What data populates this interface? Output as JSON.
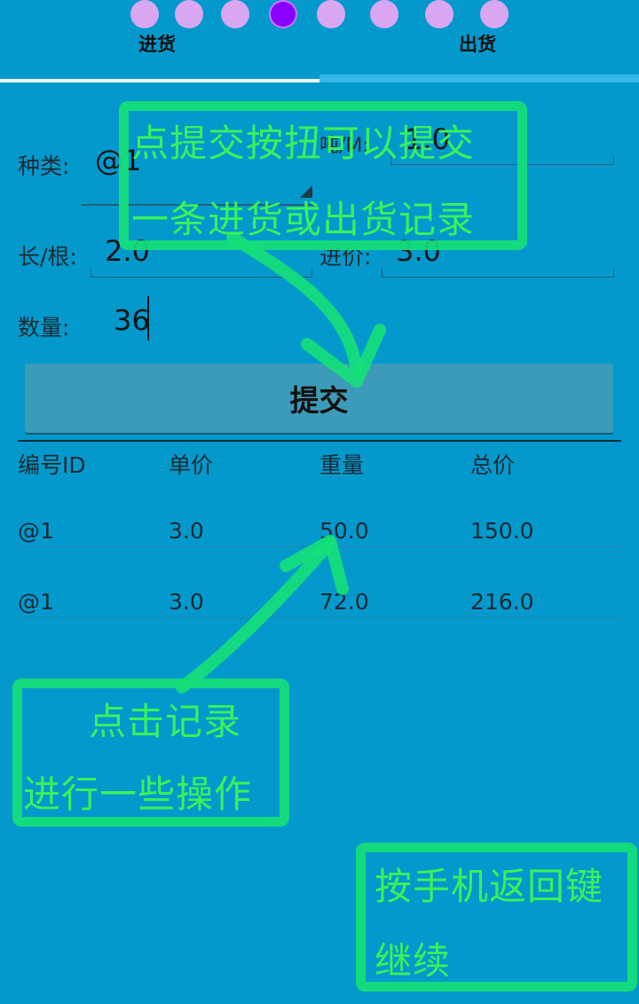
{
  "pager": {
    "dot_count": 8,
    "active_index": 3
  },
  "tabs": [
    {
      "label": "进货"
    },
    {
      "label": "出货"
    }
  ],
  "form": {
    "type_label": "种类:",
    "type_value": "@1",
    "weight_label": "吨/M:",
    "weight_value": "1.0",
    "length_label": "长/根:",
    "length_value": "2.0",
    "price_label": "进价:",
    "price_value": "3.0",
    "qty_label": "数量:",
    "qty_value": "36"
  },
  "submit_label": "提交",
  "table": {
    "headers": [
      "编号ID",
      "单价",
      "重量",
      "总价"
    ],
    "rows": [
      [
        "@1",
        "3.0",
        "50.0",
        "150.0"
      ],
      [
        "@1",
        "3.0",
        "72.0",
        "216.0"
      ]
    ]
  },
  "annotations": {
    "top_line1": "点提交按扭可以提交",
    "top_line2": "一条进货或出货记录",
    "mid_line1": "点击记录",
    "mid_line2": "进行一些操作",
    "bottom_line1": "按手机返回键",
    "bottom_line2": "继续"
  },
  "colors": {
    "background": "#0399cc",
    "annotation": "#15e078",
    "active_dot": "#8a00ff",
    "inactive_dot": "#d9a7f2"
  }
}
